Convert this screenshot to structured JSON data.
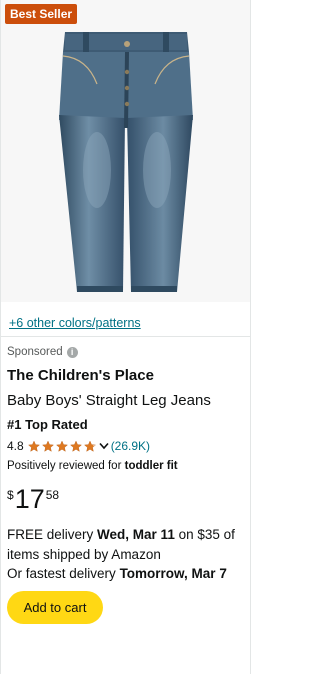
{
  "badge": {
    "label": "Best Seller"
  },
  "product": {
    "colors_link": "+6 other colors/patterns",
    "sponsored_label": "Sponsored",
    "brand": "The Children's Place",
    "title": "Baby Boys' Straight Leg Jeans",
    "top_rated": "#1 Top Rated",
    "rating": "4.8",
    "stars": 4.8,
    "review_count": "(26.9K)",
    "reviewed_prefix": "Positively reviewed for",
    "reviewed_term": "toddler fit"
  },
  "price": {
    "symbol": "$",
    "whole": "17",
    "fraction": "58"
  },
  "delivery": {
    "line1_prefix": "FREE delivery",
    "line1_date": "Wed, Mar 11",
    "line1_suffix": "on $35 of items shipped by Amazon",
    "line2_prefix": "Or fastest delivery",
    "line2_date": "Tomorrow, Mar 7"
  },
  "actions": {
    "add_to_cart": "Add to cart"
  },
  "colors": {
    "badge_bg": "#cc4e0b",
    "link": "#007185",
    "star": "#de7921",
    "cart_button": "#ffd814",
    "denim": "#4a6a84"
  },
  "icons": [
    "info-icon",
    "star-icon",
    "chevron-down-icon"
  ]
}
